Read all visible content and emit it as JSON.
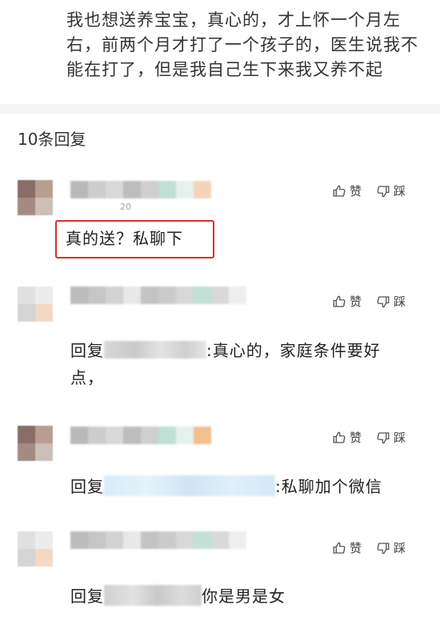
{
  "post": {
    "text": "我也想送养宝宝，真心的，才上怀一个月左右，前两个月才打了一个孩子的，医生说我不能在打了，但是我自己生下来我又养不起"
  },
  "replies_header": "10条回复",
  "actions": {
    "like": "赞",
    "dislike": "踩"
  },
  "replies": [
    {
      "comment": "真的送？私聊下",
      "time_fragment": "20"
    },
    {
      "prefix": "回复",
      "suffix": ":真心的，家庭条件要好点，"
    },
    {
      "prefix": "回复",
      "suffix": ":私聊加个微信"
    },
    {
      "prefix": "回复",
      "suffix": "你是男是女"
    }
  ],
  "colors": {
    "highlight_border": "#d9302c",
    "divider": "#f5f5f5"
  },
  "icons": [
    "thumbs-up-icon",
    "thumbs-down-icon"
  ]
}
